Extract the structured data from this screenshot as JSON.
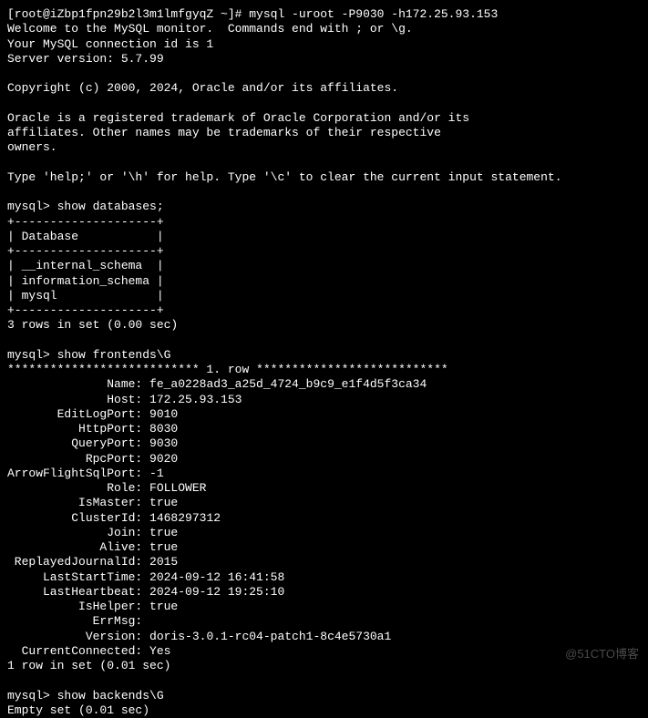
{
  "prompt1": "[root@iZbp1fpn29b2l3m1lmfgyqZ ~]# mysql -uroot -P9030 -h172.25.93.153",
  "welcome1": "Welcome to the MySQL monitor.  Commands end with ; or \\g.",
  "welcome2": "Your MySQL connection id is 1",
  "welcome3": "Server version: 5.7.99",
  "copyright": "Copyright (c) 2000, 2024, Oracle and/or its affiliates.",
  "trademark1": "Oracle is a registered trademark of Oracle Corporation and/or its",
  "trademark2": "affiliates. Other names may be trademarks of their respective",
  "trademark3": "owners.",
  "helpline": "Type 'help;' or '\\h' for help. Type '\\c' to clear the current input statement.",
  "cmd1": "mysql> show databases;",
  "tbl_border": "+--------------------+",
  "tbl_header": "| Database           |",
  "tbl_row1": "| __internal_schema  |",
  "tbl_row2": "| information_schema |",
  "tbl_row3": "| mysql              |",
  "tbl_result": "3 rows in set (0.00 sec)",
  "cmd2": "mysql> show frontends\\G",
  "rowsep": "*************************** 1. row ***************************",
  "fe": {
    "Name": "fe_a0228ad3_a25d_4724_b9c9_e1f4d5f3ca34",
    "Host": "172.25.93.153",
    "EditLogPort": "9010",
    "HttpPort": "8030",
    "QueryPort": "9030",
    "RpcPort": "9020",
    "ArrowFlightSqlPort": "-1",
    "Role": "FOLLOWER",
    "IsMaster": "true",
    "ClusterId": "1468297312",
    "Join": "true",
    "Alive": "true",
    "ReplayedJournalId": "2015",
    "LastStartTime": "2024-09-12 16:41:58",
    "LastHeartbeat": "2024-09-12 19:25:10",
    "IsHelper": "true",
    "ErrMsg": "",
    "Version": "doris-3.0.1-rc04-patch1-8c4e5730a1",
    "CurrentConnected": "Yes"
  },
  "fe_result": "1 row in set (0.01 sec)",
  "cmd3": "mysql> show backends\\G",
  "be_result": "Empty set (0.01 sec)",
  "watermark": "@51CTO博客",
  "labels": {
    "Name": "              Name: ",
    "Host": "              Host: ",
    "EditLogPort": "       EditLogPort: ",
    "HttpPort": "          HttpPort: ",
    "QueryPort": "         QueryPort: ",
    "RpcPort": "           RpcPort: ",
    "ArrowFlightSqlPort": "ArrowFlightSqlPort: ",
    "Role": "              Role: ",
    "IsMaster": "          IsMaster: ",
    "ClusterId": "         ClusterId: ",
    "Join": "              Join: ",
    "Alive": "             Alive: ",
    "ReplayedJournalId": " ReplayedJournalId: ",
    "LastStartTime": "     LastStartTime: ",
    "LastHeartbeat": "     LastHeartbeat: ",
    "IsHelper": "          IsHelper: ",
    "ErrMsg": "            ErrMsg: ",
    "Version": "           Version: ",
    "CurrentConnected": "  CurrentConnected: "
  }
}
